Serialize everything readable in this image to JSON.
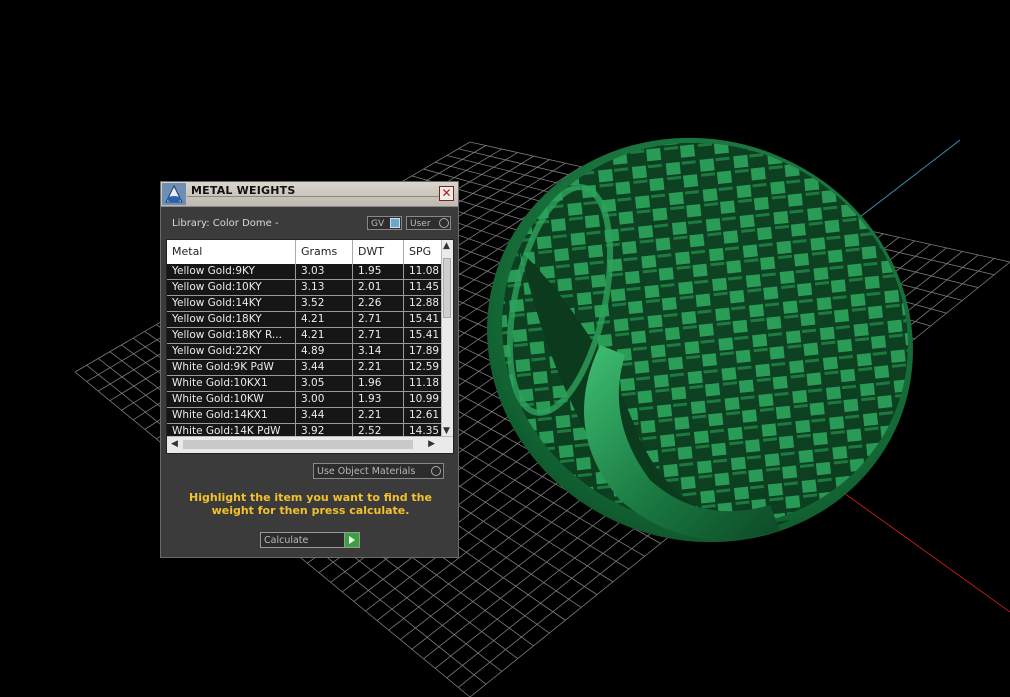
{
  "panel": {
    "title": "METAL WEIGHTS",
    "close_glyph": "✕",
    "library_label": "Library: Color Dome -",
    "toggle_gv": "GV",
    "toggle_user": "User",
    "columns": [
      "Metal",
      "Grams",
      "DWT",
      "SPG"
    ],
    "rows": [
      [
        "Yellow Gold:9KY",
        "3.03",
        "1.95",
        "11.08"
      ],
      [
        "Yellow Gold:10KY",
        "3.13",
        "2.01",
        "11.45"
      ],
      [
        "Yellow Gold:14KY",
        "3.52",
        "2.26",
        "12.88"
      ],
      [
        "Yellow Gold:18KY",
        "4.21",
        "2.71",
        "15.41"
      ],
      [
        "Yellow Gold:18KY R...",
        "4.21",
        "2.71",
        "15.41"
      ],
      [
        "Yellow Gold:22KY",
        "4.89",
        "3.14",
        "17.89"
      ],
      [
        "White Gold:9K PdW",
        "3.44",
        "2.21",
        "12.59"
      ],
      [
        "White Gold:10KX1",
        "3.05",
        "1.96",
        "11.18"
      ],
      [
        "White Gold:10KW",
        "3.00",
        "1.93",
        "10.99"
      ],
      [
        "White Gold:14KX1",
        "3.44",
        "2.21",
        "12.61"
      ],
      [
        "White Gold:14K PdW",
        "3.92",
        "2.52",
        "14.35"
      ]
    ],
    "use_object_materials": "Use Object Materials",
    "hint": "Highlight the item you want to find the weight for then press calculate.",
    "calculate_label": "Calculate"
  },
  "colors": {
    "viewport_bg": "#000000",
    "grid_line": "#8a8a8a",
    "ring_green": "#1f8a4c",
    "axis_red": "#b01a1a",
    "axis_blue": "#3a8fb0",
    "hint_text": "#f2c12e"
  }
}
